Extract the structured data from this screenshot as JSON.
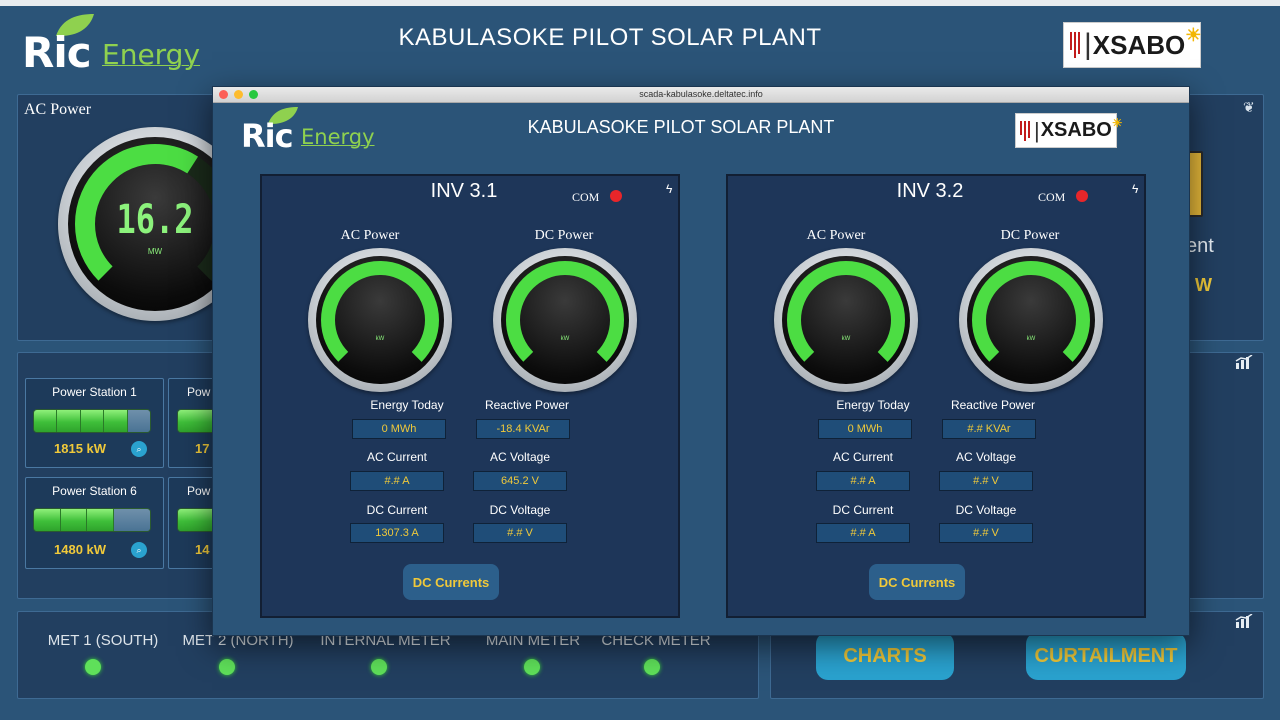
{
  "header": {
    "logo_main": "Ric",
    "logo_sub": "Energy",
    "title": "KABULASOKE PILOT SOLAR PLANT",
    "partner_logo": "XSABO"
  },
  "ac_panel": {
    "label": "AC Power",
    "value": "16.2",
    "unit": "MW",
    "gauge_fill": 0.62
  },
  "stations": [
    {
      "name": "Power Station 1",
      "value": "1815 kW",
      "fill": 0.8
    },
    {
      "name": "Pow",
      "value": "17",
      "fill": 0.8
    },
    {
      "name": "Power Station 6",
      "value": "1480 kW",
      "fill": 0.6
    },
    {
      "name": "Pow",
      "value": "14",
      "fill": 0.6
    }
  ],
  "right_partial": {
    "text": "ent",
    "unit": "W"
  },
  "meters": [
    {
      "label": "MET 1 (SOUTH)",
      "status": "on"
    },
    {
      "label": "MET 2 (NORTH)",
      "status": "on"
    },
    {
      "label": "INTERNAL METER",
      "status": "on"
    },
    {
      "label": "MAIN METER",
      "status": "on"
    },
    {
      "label": "CHECK METER",
      "status": "on"
    }
  ],
  "buttons": {
    "charts": "CHARTS",
    "curtailment": "CURTAILMENT"
  },
  "browser": {
    "url": "scada-kabulasoke.deltatec.info",
    "title": "KABULASOKE PILOT SOLAR PLANT"
  },
  "inverters": [
    {
      "title": "INV 3.1",
      "com_label": "COM",
      "ac_label": "AC Power",
      "dc_label": "DC Power",
      "gauge_unit": "kW",
      "fields": {
        "energy_today_label": "Energy Today",
        "energy_today": "0 MWh",
        "reactive_label": "Reactive Power",
        "reactive": "-18.4 KVAr",
        "ac_current_label": "AC Current",
        "ac_current": "#.# A",
        "ac_voltage_label": "AC Voltage",
        "ac_voltage": "645.2 V",
        "dc_current_label": "DC Current",
        "dc_current": "1307.3 A",
        "dc_voltage_label": "DC Voltage",
        "dc_voltage": "#.# V"
      },
      "dc_button": "DC Currents"
    },
    {
      "title": "INV 3.2",
      "com_label": "COM",
      "ac_label": "AC Power",
      "dc_label": "DC Power",
      "gauge_unit": "kW",
      "fields": {
        "energy_today_label": "Energy Today",
        "energy_today": "0 MWh",
        "reactive_label": "Reactive Power",
        "reactive": "#.# KVAr",
        "ac_current_label": "AC Current",
        "ac_current": "#.# A",
        "ac_voltage_label": "AC Voltage",
        "ac_voltage": "#.# V",
        "dc_current_label": "DC Current",
        "dc_current": "#.# A",
        "dc_voltage_label": "DC Voltage",
        "dc_voltage": "#.# V"
      },
      "dc_button": "DC Currents"
    }
  ],
  "colors": {
    "accent_green": "#3fbf3a",
    "value_yellow": "#f0c93a",
    "panel_bg": "#223f60",
    "status_red": "#e8262a"
  },
  "icons": [
    "lightning-icon",
    "leaf-icon",
    "chart-icon",
    "search-icon"
  ]
}
